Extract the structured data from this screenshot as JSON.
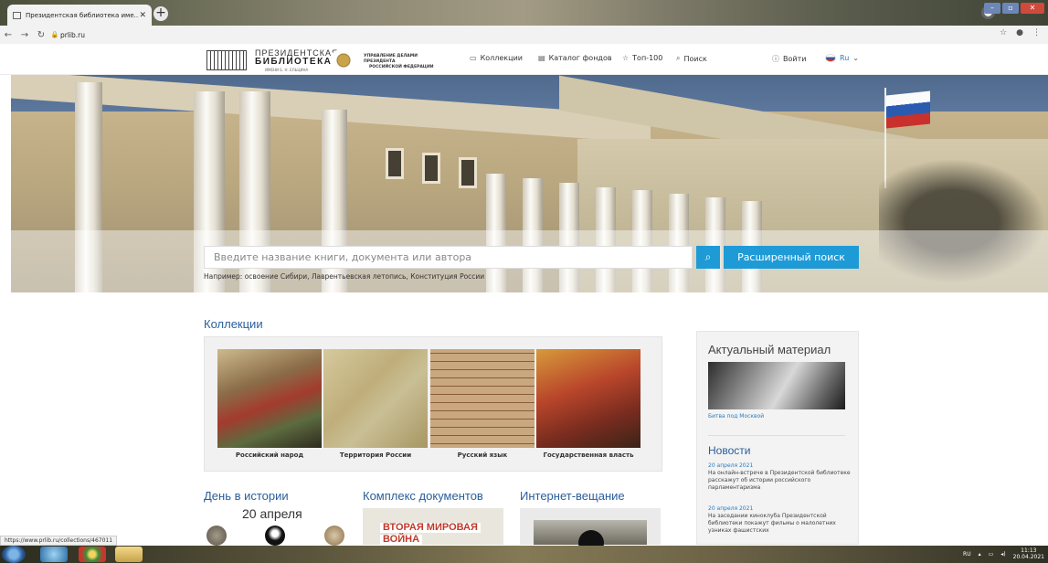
{
  "browser": {
    "tab_title": "Президентская библиотека име...",
    "url": "prlib.ru",
    "status_url": "https://www.prlib.ru/collections/467011"
  },
  "site": {
    "logo_line1": "ПРЕЗИДЕНТСКАЯ",
    "logo_line2": "БИБЛИОТЕКА",
    "logo_line3": "ИМЕНИ Б. Н. ЕЛЬЦИНА",
    "udp_line1": "УПРАВЛЕНИЕ ДЕЛАМИ ПРЕЗИДЕНТА",
    "udp_line2": "РОССИЙСКОЙ ФЕДЕРАЦИИ",
    "nav": [
      "Коллекции",
      "Каталог фондов",
      "Топ-100",
      "Поиск"
    ],
    "login": "Войти",
    "lang": "Ru"
  },
  "search": {
    "placeholder": "Введите название книги, документа или автора",
    "button_advanced": "Расширенный поиск",
    "example": "Например: освоение Сибири, Лаврентьевская летопись, Конституция России"
  },
  "collections": {
    "heading": "Коллекции",
    "items": [
      "Российский народ",
      "Территория России",
      "Русский язык",
      "Государственная власть"
    ]
  },
  "day_in_history": {
    "heading": "День в истории",
    "date": "20 апреля"
  },
  "documents": {
    "heading": "Комплекс документов",
    "thumb_title_1": "ВТОРАЯ МИРОВАЯ",
    "thumb_title_2": "ВОЙНА"
  },
  "streaming": {
    "heading": "Интернет-вещание"
  },
  "sidebar": {
    "actual_heading": "Актуальный материал",
    "actual_caption": "Битва под Москвой",
    "news_heading": "Новости",
    "news": [
      {
        "date": "20 апреля 2021",
        "text": "На онлайн-встрече в Президентской библиотеке расскажут об истории российского парламентаризма"
      },
      {
        "date": "20 апреля 2021",
        "text": "На заседании киноклуба Президентской библиотеки покажут фильмы о малолетних узниках фашистских"
      }
    ]
  },
  "taskbar": {
    "lang": "RU",
    "time": "11:13",
    "date": "20.04.2021"
  }
}
